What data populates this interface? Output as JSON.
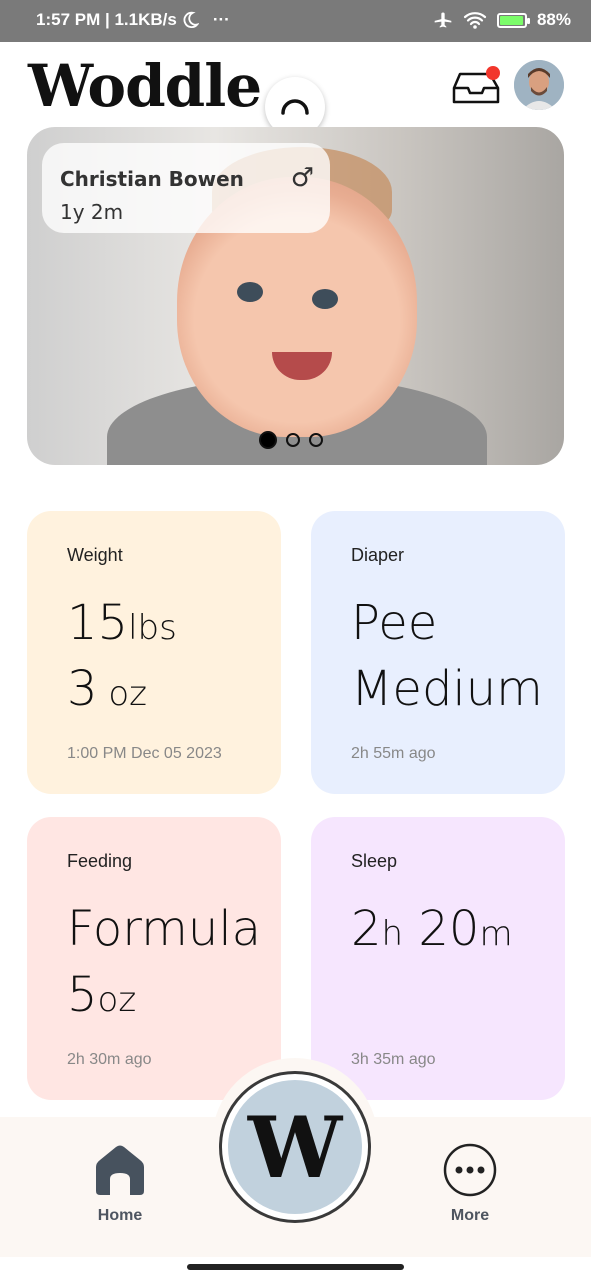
{
  "status_bar": {
    "time_speed": "1:57 PM | 1.1KB/s",
    "overflow": "···",
    "battery": "88%",
    "battery_level": 0.88
  },
  "header": {
    "logo": "Woddle",
    "notification_dot_color": "#f2362c"
  },
  "hero": {
    "baby_name": "Christian Bowen",
    "age": "1y 2m",
    "gender_symbol": "♂",
    "carousel_active_index": 0,
    "carousel_count": 3
  },
  "cards": {
    "weight": {
      "label": "Weight",
      "value1": "15",
      "unit1": "lbs",
      "value2": "3",
      "unit2": " oz",
      "time": "1:00 PM Dec 05 2023",
      "color": "#fff2de"
    },
    "diaper": {
      "label": "Diaper",
      "line1": "Pee",
      "line2": "Medium",
      "time": "2h 55m ago",
      "color": "#e8effe"
    },
    "feeding": {
      "label": "Feeding",
      "line1": "Formula",
      "value2": "5",
      "unit2": "oz",
      "time": "2h 30m ago",
      "color": "#ffe6e3"
    },
    "sleep": {
      "label": "Sleep",
      "hours": "2",
      "h_unit": "h",
      "minutes": " 20",
      "m_unit": "m",
      "time": "3h 35m ago",
      "color": "#f6e6fe"
    }
  },
  "bottom_nav": {
    "home_label": "Home",
    "more_label": "More",
    "fab_letter": "W"
  }
}
